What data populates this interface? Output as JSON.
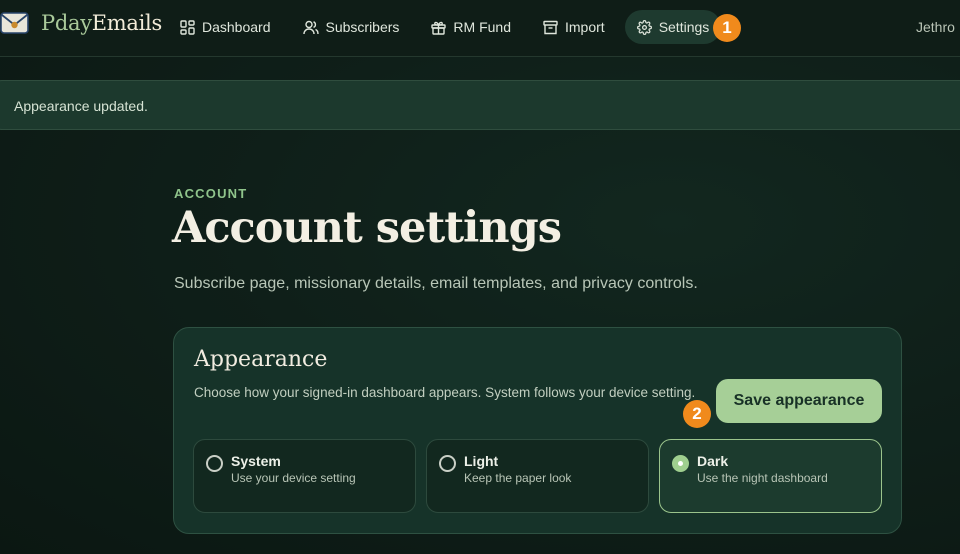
{
  "brand": {
    "name_part1": "Pday",
    "name_part2": "Emails"
  },
  "nav": {
    "items": [
      {
        "label": "Dashboard",
        "icon": "grid-icon"
      },
      {
        "label": "Subscribers",
        "icon": "users-icon"
      },
      {
        "label": "RM Fund",
        "icon": "gift-icon"
      },
      {
        "label": "Import",
        "icon": "archive-icon"
      },
      {
        "label": "Settings",
        "icon": "gear-icon",
        "active": true
      }
    ],
    "user_name": "Jethro"
  },
  "badges": {
    "first": "1",
    "second": "2"
  },
  "toast": {
    "message": "Appearance updated."
  },
  "header": {
    "eyebrow": "ACCOUNT",
    "title": "Account settings",
    "subtitle": "Subscribe page, missionary details, email templates, and privacy controls."
  },
  "appearance": {
    "title": "Appearance",
    "description": "Choose how your signed-in dashboard appears. System follows your device setting.",
    "save_label": "Save appearance",
    "options": [
      {
        "title": "System",
        "description": "Use your device setting",
        "selected": false
      },
      {
        "title": "Light",
        "description": "Keep the paper look",
        "selected": false
      },
      {
        "title": "Dark",
        "description": "Use the night dashboard",
        "selected": true
      }
    ]
  },
  "colors": {
    "accent": "#a6cf97",
    "badge": "#f08a1c",
    "background": "#0f1f19"
  }
}
